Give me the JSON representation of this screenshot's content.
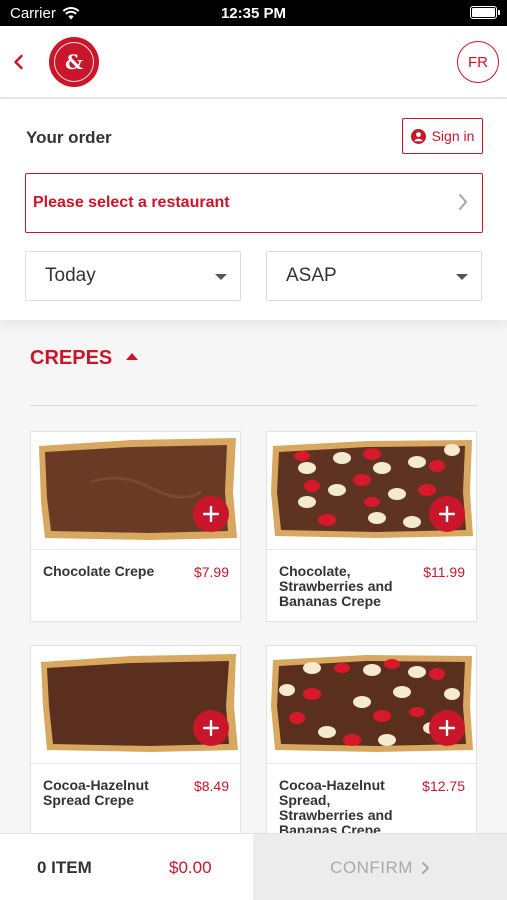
{
  "status_bar": {
    "carrier": "Carrier",
    "time": "12:35 PM"
  },
  "nav": {
    "logo_amp": "&",
    "lang": "FR"
  },
  "order": {
    "title": "Your order",
    "sign_in": "Sign in",
    "restaurant_placeholder": "Please select a restaurant",
    "day": "Today",
    "time": "ASAP"
  },
  "section": {
    "title": "CREPES"
  },
  "products": [
    {
      "name": "Chocolate Crepe",
      "price": "$7.99",
      "topping": "chocolate"
    },
    {
      "name": "Chocolate, Strawberries and Bananas Crepe",
      "price": "$11.99",
      "topping": "fruit"
    },
    {
      "name": "Cocoa-Hazelnut Spread Crepe",
      "price": "$8.49",
      "topping": "chocolate"
    },
    {
      "name": "Cocoa-Hazelnut Spread, Strawberries and Bananas Crepe",
      "price": "$12.75",
      "topping": "fruit"
    }
  ],
  "cart": {
    "items": "0 ITEM",
    "total": "$0.00",
    "confirm": "CONFIRM"
  },
  "colors": {
    "brand_red": "#c9162b",
    "chocolate": "#6b3a25",
    "crepe": "#d8a760"
  }
}
